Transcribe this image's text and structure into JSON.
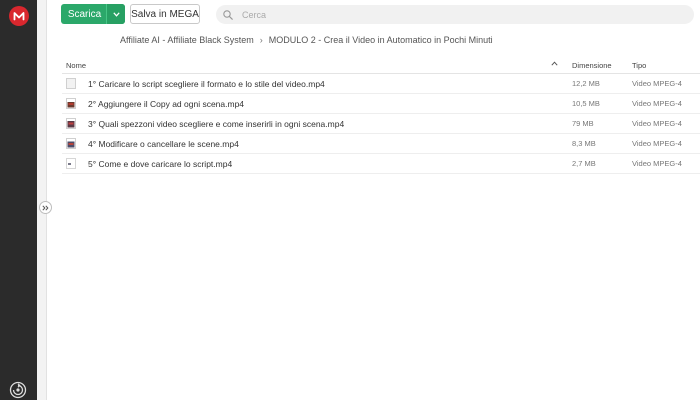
{
  "toolbar": {
    "download_label": "Scarica",
    "save_label": "Salva in MEGA"
  },
  "search": {
    "placeholder": "Cerca"
  },
  "breadcrumb": {
    "items": [
      "Affiliate AI - Affiliate Black System",
      "MODULO 2 - Crea il Video in Automatico in Pochi Minuti"
    ]
  },
  "table": {
    "columns": {
      "name": "Nome",
      "size": "Dimensione",
      "type": "Tipo"
    },
    "rows": [
      {
        "name": "1° Caricare lo script scegliere il formato e lo stile del video.mp4",
        "size": "12,2 MB",
        "type": "Video MPEG-4",
        "thumb": "blank"
      },
      {
        "name": "2° Aggiungere il Copy ad ogni scena.mp4",
        "size": "10,5 MB",
        "type": "Video MPEG-4",
        "thumb": "video"
      },
      {
        "name": "3° Quali spezzoni video scegliere e come inserirli in ogni scena.mp4",
        "size": "79 MB",
        "type": "Video MPEG-4",
        "thumb": "video"
      },
      {
        "name": "4° Modificare o cancellare le scene.mp4",
        "size": "8,3 MB",
        "type": "Video MPEG-4",
        "thumb": "video"
      },
      {
        "name": "5° Come e dove caricare lo script.mp4",
        "size": "2,7 MB",
        "type": "Video MPEG-4",
        "thumb": "small"
      }
    ]
  },
  "colors": {
    "accent": "#2ba86a",
    "brand": "#d9272e",
    "sidebar": "#2b2b2b"
  }
}
